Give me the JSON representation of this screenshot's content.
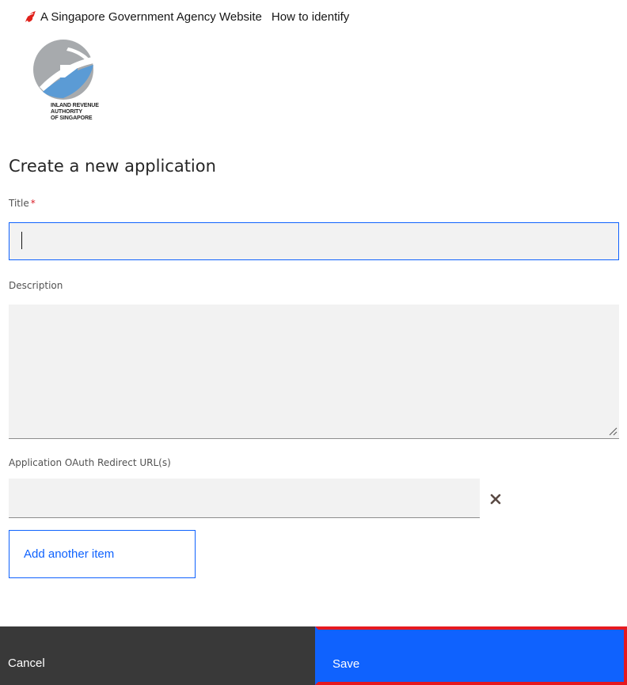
{
  "masthead": {
    "agency_text": "A Singapore Government Agency Website",
    "how_to_identify": "How to identify"
  },
  "logo": {
    "text_line1": "INLAND REVENUE",
    "text_line2": "AUTHORITY",
    "text_line3": "OF SINGAPORE"
  },
  "page": {
    "title": "Create a new application"
  },
  "form": {
    "title_label": "Title",
    "title_required_mark": "*",
    "title_value": "",
    "description_label": "Description",
    "description_value": "",
    "redirect_label": "Application OAuth Redirect URL(s)",
    "redirect_value": "",
    "add_item_label": "Add another item"
  },
  "footer": {
    "cancel_label": "Cancel",
    "save_label": "Save"
  },
  "colors": {
    "primary": "#0f62fe",
    "secondary": "#393939",
    "highlight": "#e5191f",
    "required": "#da1e28"
  }
}
